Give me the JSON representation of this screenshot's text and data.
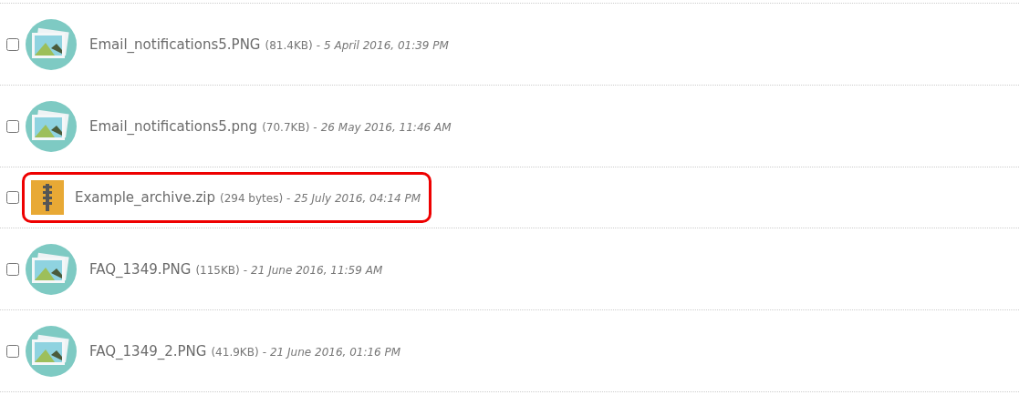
{
  "files": [
    {
      "kind": "image",
      "name": "Email_notifications5.PNG",
      "size": "(81.4KB)",
      "separator": "-",
      "date": "5 April 2016, 01:39 PM",
      "checked": false,
      "highlighted": false
    },
    {
      "kind": "image",
      "name": "Email_notifications5.png",
      "size": "(70.7KB)",
      "separator": "-",
      "date": "26 May 2016, 11:46 AM",
      "checked": false,
      "highlighted": false
    },
    {
      "kind": "archive",
      "name": "Example_archive.zip",
      "size": "(294 bytes)",
      "separator": "-",
      "date": "25 July 2016, 04:14 PM",
      "checked": false,
      "highlighted": true
    },
    {
      "kind": "image",
      "name": "FAQ_1349.PNG",
      "size": "(115KB)",
      "separator": "-",
      "date": "21 June 2016, 11:59 AM",
      "checked": false,
      "highlighted": false
    },
    {
      "kind": "image",
      "name": "FAQ_1349_2.PNG",
      "size": "(41.9KB)",
      "separator": "-",
      "date": "21 June 2016, 01:16 PM",
      "checked": false,
      "highlighted": false
    }
  ]
}
